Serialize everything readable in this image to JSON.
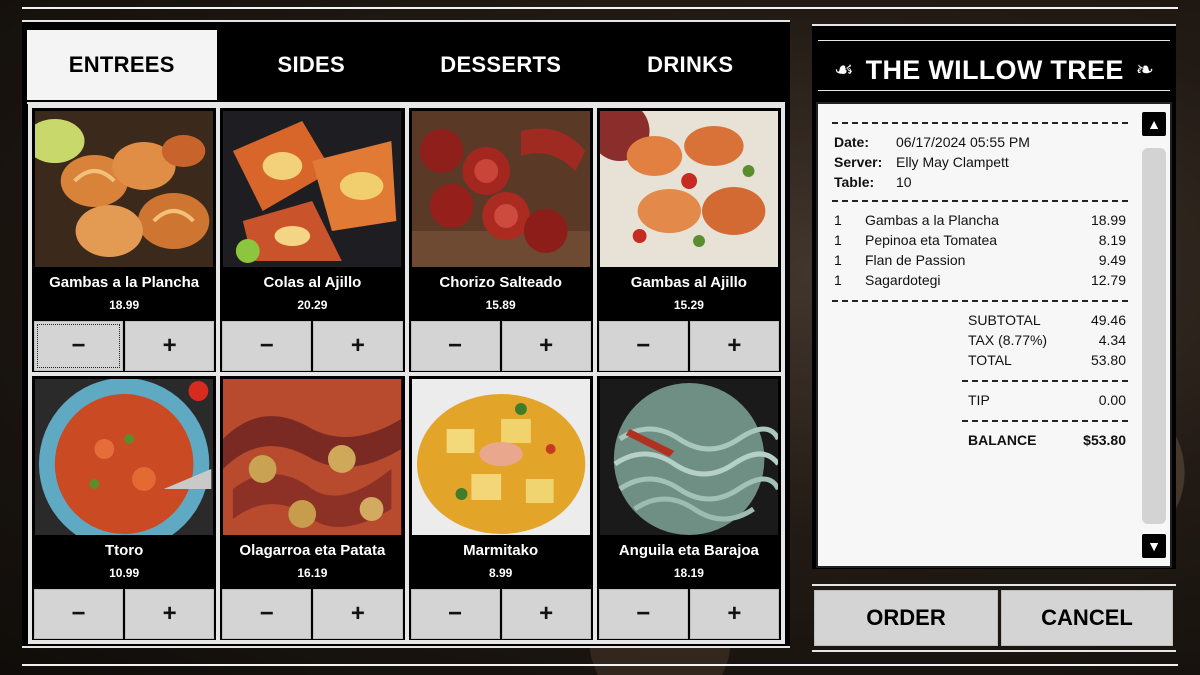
{
  "tabs": [
    {
      "label": "ENTREES",
      "active": true
    },
    {
      "label": "SIDES",
      "active": false
    },
    {
      "label": "DESSERTS",
      "active": false
    },
    {
      "label": "DRINKS",
      "active": false
    }
  ],
  "items": [
    {
      "name": "Gambas a la Plancha",
      "price": "18.99",
      "photo": "grilled-shrimp"
    },
    {
      "name": "Colas al Ajillo",
      "price": "20.29",
      "photo": "lobster-tails"
    },
    {
      "name": "Chorizo Salteado",
      "price": "15.89",
      "photo": "chorizo"
    },
    {
      "name": "Gambas al Ajillo",
      "price": "15.29",
      "photo": "garlic-shrimp"
    },
    {
      "name": "Ttoro",
      "price": "10.99",
      "photo": "fish-soup"
    },
    {
      "name": "Olagarroa eta Patata",
      "price": "16.19",
      "photo": "octopus-potatoes"
    },
    {
      "name": "Marmitako",
      "price": "8.99",
      "photo": "tuna-stew"
    },
    {
      "name": "Anguila eta Barajoa",
      "price": "18.19",
      "photo": "baby-eels"
    }
  ],
  "qty": {
    "minus": "−",
    "plus": "+"
  },
  "restaurant": {
    "name": "THE WILLOW TREE",
    "ornament_left": "☙",
    "ornament_right": "❧"
  },
  "receipt": {
    "date_label": "Date:",
    "date": "06/17/2024 05:55 PM",
    "server_label": "Server:",
    "server": "Elly May Clampett",
    "table_label": "Table:",
    "table": "10",
    "lines": [
      {
        "qty": "1",
        "name": "Gambas a la Plancha",
        "amount": "18.99"
      },
      {
        "qty": "1",
        "name": "Pepinoa eta Tomatea",
        "amount": "8.19"
      },
      {
        "qty": "1",
        "name": "Flan de Passion",
        "amount": "9.49"
      },
      {
        "qty": "1",
        "name": "Sagardotegi",
        "amount": "12.79"
      }
    ],
    "subtotal_label": "SUBTOTAL",
    "subtotal": "49.46",
    "tax_label": "TAX (8.77%)",
    "tax": "4.34",
    "total_label": "TOTAL",
    "total": "53.80",
    "tip_label": "TIP",
    "tip": "0.00",
    "balance_label": "BALANCE",
    "balance": "$53.80"
  },
  "scroll": {
    "up": "▲",
    "down": "▼"
  },
  "actions": {
    "order": "ORDER",
    "cancel": "CANCEL"
  }
}
